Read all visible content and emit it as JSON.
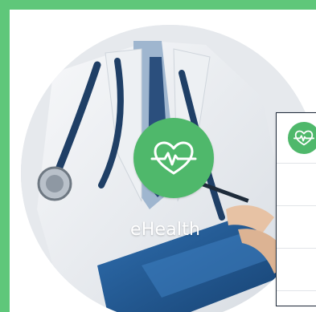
{
  "brand": {
    "name": "eHealth",
    "accent_color": "#4fb86b",
    "frame_color": "#5fc77a",
    "logo_icon": "heart-pulse-icon"
  },
  "side_panel": {
    "logo_icon": "heart-pulse-icon",
    "rows": [
      "",
      "",
      ""
    ]
  }
}
